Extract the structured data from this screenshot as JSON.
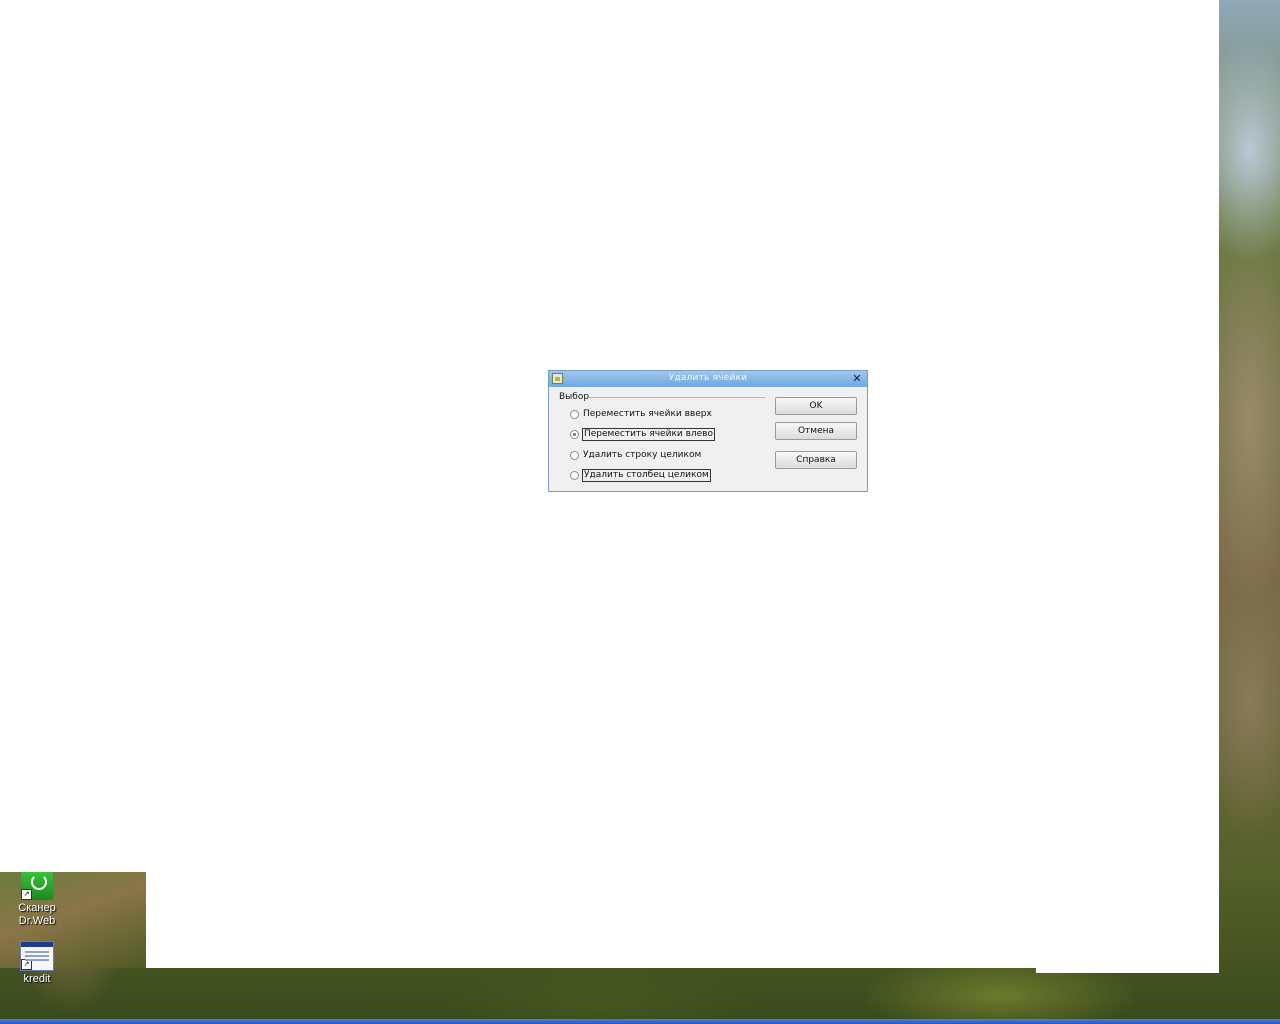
{
  "dialog": {
    "title": "Удалить ячейки",
    "close_glyph": "✕",
    "group_label": "Выбор",
    "options": [
      {
        "label": "Переместить ячейки вверх",
        "checked": false
      },
      {
        "label": "Переместить ячейки влево",
        "checked": true
      },
      {
        "label": "Удалить строку целиком",
        "checked": false
      },
      {
        "label": "Удалить столбец целиком",
        "checked": false
      }
    ],
    "buttons": {
      "ok": "OK",
      "cancel": "Отмена",
      "help": "Справка"
    }
  },
  "desktop": {
    "icons": [
      {
        "label_line1": "Сканер",
        "label_line2": "Dr.Web",
        "icon": "drweb-scanner-icon"
      },
      {
        "label_line1": "kredit",
        "icon": "kredit-app-icon"
      }
    ],
    "shortcut_glyph": "↗"
  },
  "colors": {
    "titlebar": "#7fb2e5",
    "dialog_bg": "#f0f0f0",
    "taskbar": "#2f63cc"
  }
}
